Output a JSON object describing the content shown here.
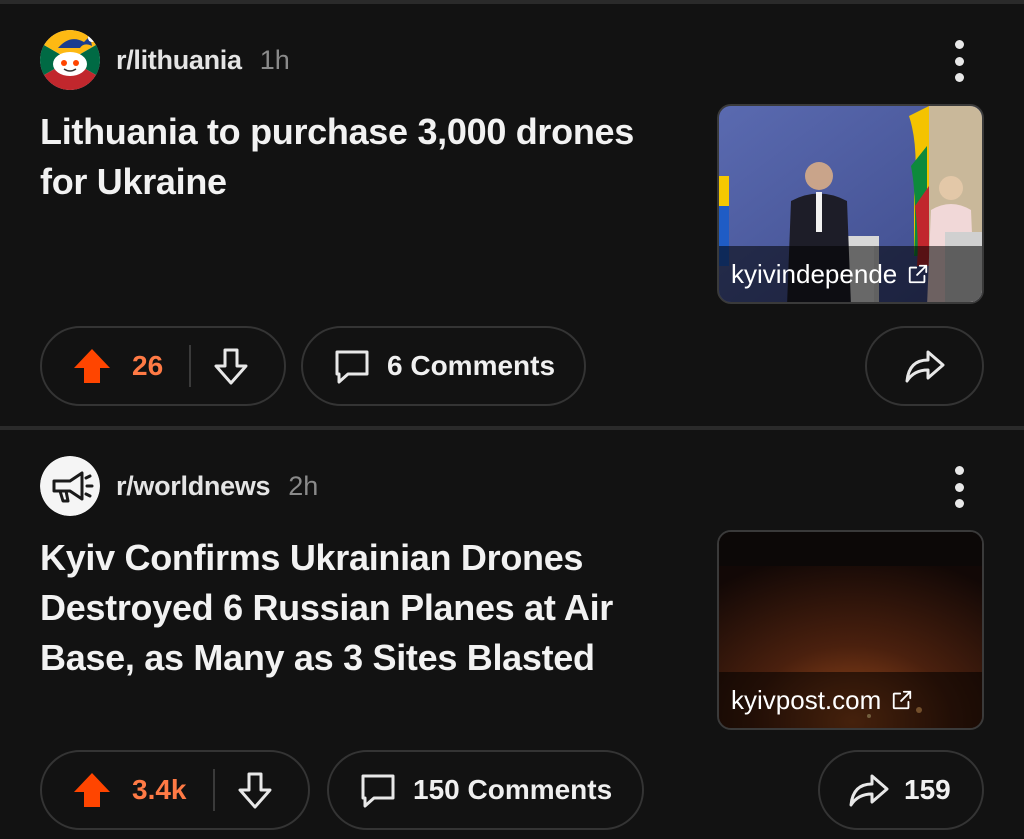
{
  "posts": [
    {
      "subreddit": "r/lithuania",
      "time": "1h",
      "title": "Lithuania to purchase 3,000 drones for Ukraine",
      "thumbnail_domain": "kyivindepende",
      "score": "26",
      "comments": "6 Comments",
      "share_count": ""
    },
    {
      "subreddit": "r/worldnews",
      "time": "2h",
      "title": "Kyiv Confirms Ukrainian Drones Destroyed 6 Russian Planes at Air Base, as Many as 3 Sites Blasted",
      "thumbnail_domain": "kyivpost.com",
      "score": "3.4k",
      "comments": "150 Comments",
      "share_count": "159"
    }
  ],
  "colors": {
    "background": "#121212",
    "upvote_accent": "#ff4500",
    "score_text": "#ff7a45",
    "divider": "#2a2a2a"
  },
  "icons": {
    "menu": "more-vertical-icon",
    "upvote": "upvote-arrow-icon",
    "downvote": "downvote-arrow-icon",
    "comment": "comment-bubble-icon",
    "share": "share-arrow-icon",
    "external_link": "external-link-icon"
  }
}
